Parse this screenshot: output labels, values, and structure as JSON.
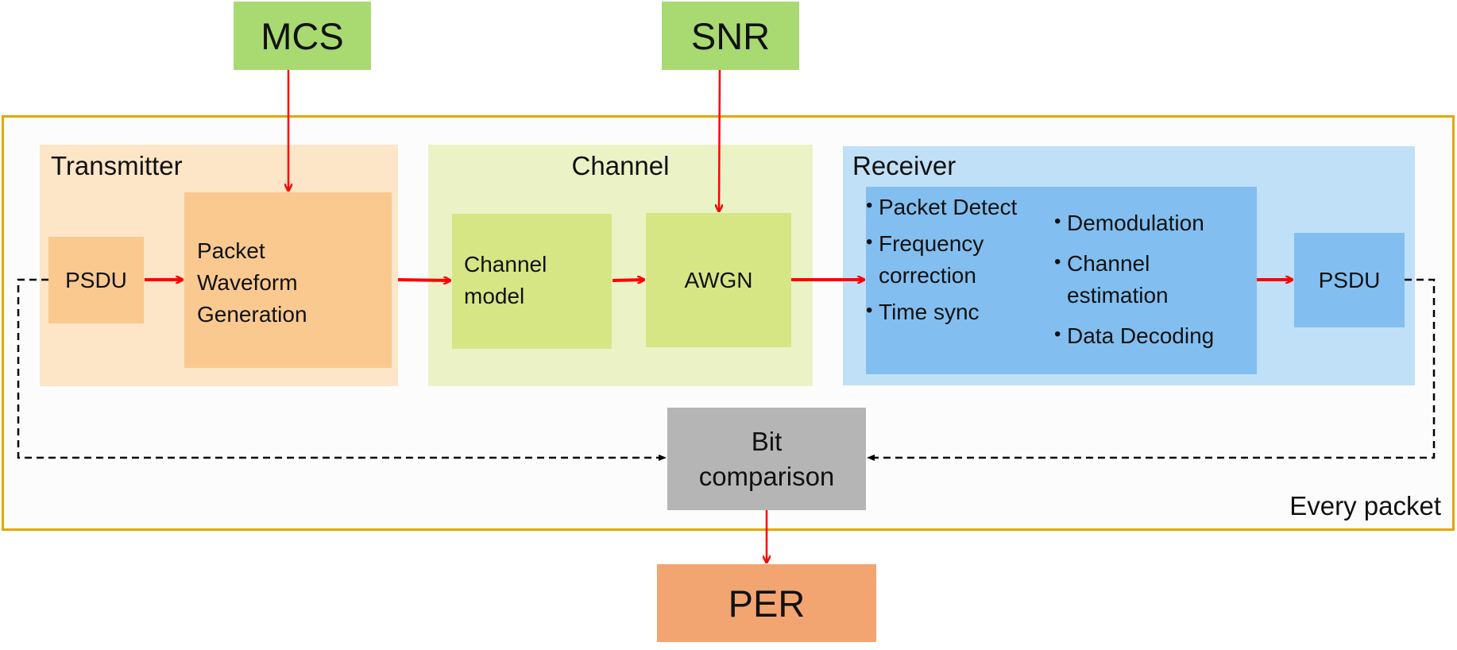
{
  "inputs": {
    "mcs": "MCS",
    "snr": "SNR"
  },
  "frame": {
    "label": "Every packet"
  },
  "transmitter": {
    "title": "Transmitter",
    "psdu": "PSDU",
    "waveform": [
      "Packet",
      "Waveform",
      "Generation"
    ]
  },
  "channel": {
    "title": "Channel",
    "model": [
      "Channel",
      "model"
    ],
    "awgn": "AWGN"
  },
  "receiver": {
    "title": "Receiver",
    "left_steps": [
      "Packet Detect",
      "Frequency correction",
      "Time sync"
    ],
    "right_steps": [
      "Demodulation",
      "Channel estimation",
      "Data Decoding"
    ],
    "psdu": "PSDU"
  },
  "comparison": {
    "label": [
      "Bit",
      "comparison"
    ]
  },
  "output": {
    "per": "PER"
  },
  "colors": {
    "input": "#a9d971",
    "frame": "#e0a800",
    "arrow": "#ff0000",
    "tx_bg": "#fde5c8",
    "tx_box": "#f9c990",
    "ch_bg": "#ebf3c6",
    "ch_box": "#d6e685",
    "rx_bg": "#c0e0f7",
    "rx_box": "#82bff0",
    "compare": "#b5b5b5",
    "per": "#f2a571"
  }
}
